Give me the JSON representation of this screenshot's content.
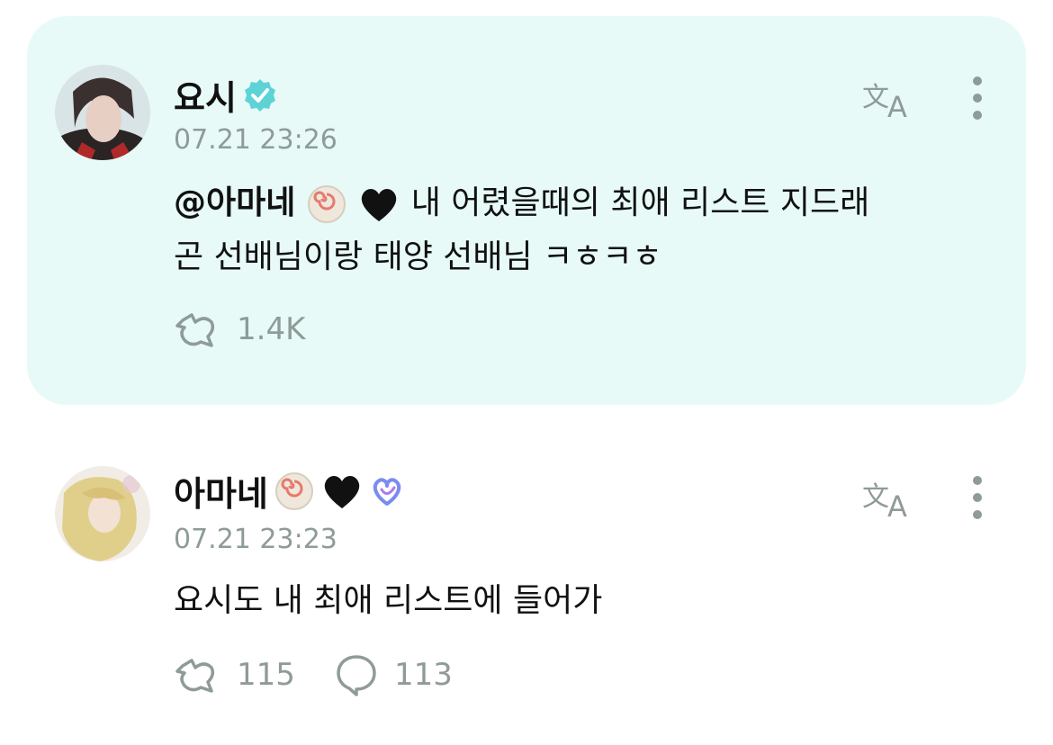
{
  "post1": {
    "username": "요시",
    "timestamp": "07.21 23:26",
    "mention": "@아마네",
    "text_line1": "내 어렸을때의 최애 리스트 지드래",
    "text_line2": "곤 선배님이랑 태양 선배님 ㅋㅎㅋㅎ",
    "likes": "1.4K",
    "verified_badge_color": "#5ed3d6"
  },
  "post2": {
    "username": "아마네",
    "timestamp": "07.21 23:23",
    "text": "요시도 내 최애 리스트에 들어가",
    "likes": "115",
    "comments": "113"
  },
  "colors": {
    "highlight_bg": "#e7faf7",
    "muted": "#8f9b99",
    "text": "#111111"
  },
  "icons": [
    "translate-icon",
    "more-vertical-icon",
    "like-icon",
    "comment-icon",
    "verified-badge-icon",
    "fishcake-emoji",
    "black-heart-emoji",
    "blue-heart-loop-icon"
  ]
}
